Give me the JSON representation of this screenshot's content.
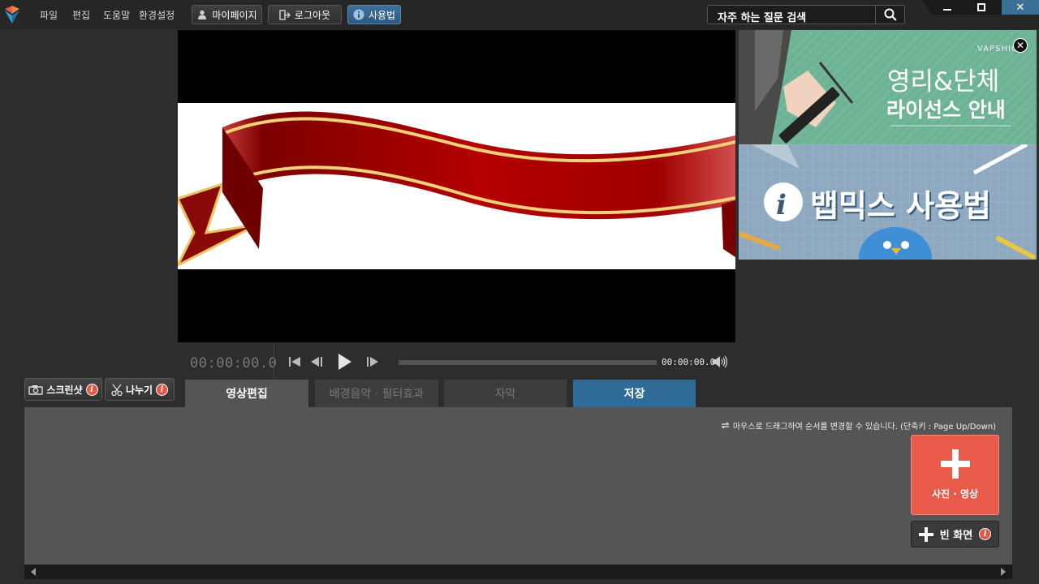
{
  "menu": [
    "파일",
    "편집",
    "도움말",
    "환경설정"
  ],
  "toolbar": {
    "mypage_label": "마이페이지",
    "logout_label": "로그아웃",
    "howto_label": "사용법"
  },
  "search": {
    "text": "자주 하는 질문 검색"
  },
  "window": {
    "minimize": "▬",
    "maximize": "■",
    "close": "✕"
  },
  "player": {
    "timecode": "00:00:00.0",
    "end_time": "00:00:00.0",
    "progress": 0
  },
  "ads": {
    "top": {
      "brand": "VAPSHION",
      "line1": "영리&단체",
      "line2": "라이선스 안내",
      "close": "✕"
    },
    "bottom": {
      "title": "뱁믹스 사용법"
    }
  },
  "tools": {
    "screenshot_label": "스크린샷",
    "split_label": "나누기",
    "info": "i"
  },
  "tabs": [
    "영상편집",
    "배경음악 · 필터효과",
    "자막",
    "저장"
  ],
  "panel": {
    "hint": "마우스로 드래그하여 순서를 변경할 수 있습니다.  (단축키 : Page Up/Down)",
    "add_media_label": "사진 · 영상",
    "add_blank_label": "빈 화면"
  },
  "colors": {
    "accent": "#2f6b96",
    "add_button": "#e95a4b",
    "info_dot": "#e4584a"
  }
}
